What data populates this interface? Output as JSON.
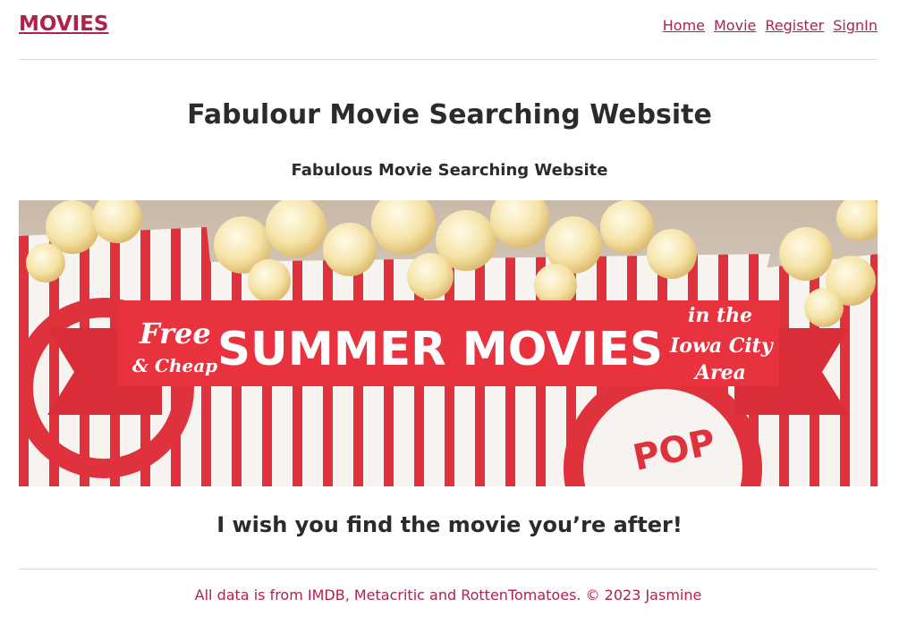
{
  "header": {
    "brand": "MOVIES",
    "nav": [
      "Home",
      "Movie",
      "Register",
      "SignIn"
    ]
  },
  "main": {
    "title": "Fabulour Movie Searching Website",
    "subtitle": "Fabulous Movie Searching Website",
    "banner": {
      "free": "Free",
      "cheap": "& Cheap",
      "headline": "SUMMER MOVIES",
      "right_line1": "in the",
      "right_line2": "Iowa City",
      "right_line3": "Area",
      "box_text": "POP"
    },
    "tagline": "I wish you find the movie you’re after!"
  },
  "footer": {
    "text": "All data is from IMDB, Metacritic and RottenTomatoes. © 2023 Jasmine"
  },
  "colors": {
    "accent": "#b0224a",
    "banner_red": "#e8323d",
    "ribbon_red": "#d92d37",
    "text": "#2b2b2b"
  }
}
